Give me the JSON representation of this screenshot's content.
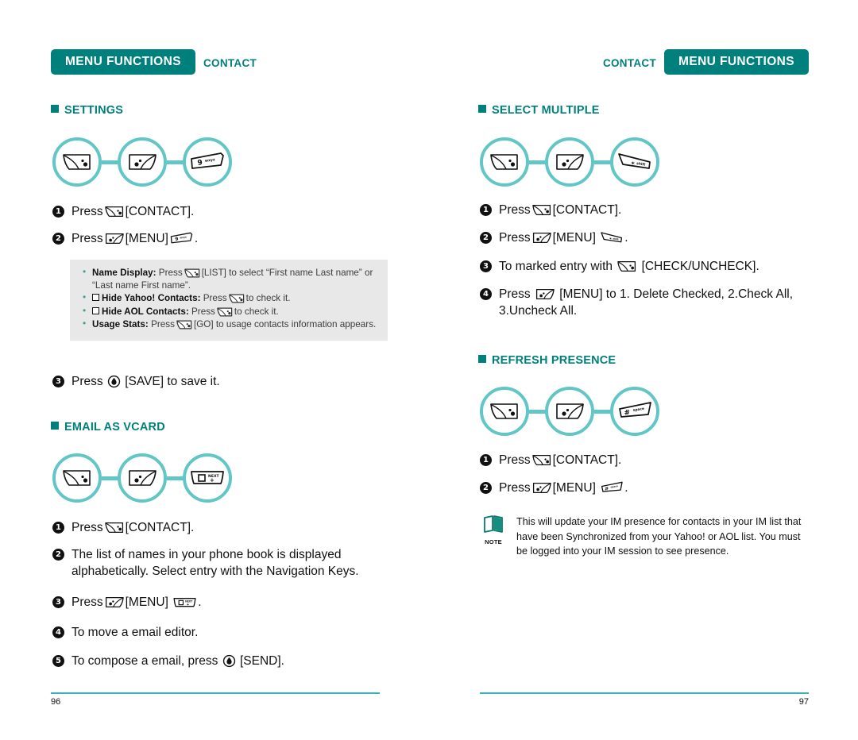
{
  "left_page": {
    "header": {
      "pill": "MENU FUNCTIONS",
      "side": "CONTACT"
    },
    "page_number": "96",
    "sections": [
      {
        "title": "SETTINGS",
        "icons": [
          "left-softkey",
          "right-softkey",
          "key-9-wxyz"
        ],
        "steps": [
          {
            "num": "1",
            "pre": "Press",
            "icons": [
              "left-softkey"
            ],
            "post": "[CONTACT]."
          },
          {
            "num": "2",
            "pre": "Press",
            "icons": [
              "right-softkey"
            ],
            "mid": "[MENU]",
            "icons2": [
              "key-9-wxyz"
            ],
            "post": "."
          },
          {
            "num": "3",
            "pre": "Press",
            "icons": [
              "ok-key"
            ],
            "post": "[SAVE] to save it."
          }
        ],
        "tips": [
          {
            "label": "Name Display:",
            "text_a": "Press",
            "icon": "left-softkey",
            "text_b": "[LIST] to select “First name Last name” or “Last name First name”.",
            "checkbox": false
          },
          {
            "label": "Hide Yahoo! Contacts:",
            "text_a": "Press",
            "icon": "left-softkey",
            "text_b": "to check it.",
            "checkbox": true
          },
          {
            "label": "Hide AOL Contacts:",
            "text_a": "Press",
            "icon": "left-softkey",
            "text_b": "to check it.",
            "checkbox": true
          },
          {
            "label": "Usage Stats:",
            "text_a": "Press",
            "icon": "left-softkey",
            "text_b": "[GO] to usage contacts information appears.",
            "checkbox": false
          }
        ]
      },
      {
        "title": "EMAIL AS VCARD",
        "icons": [
          "left-softkey",
          "right-softkey",
          "key-0-next"
        ],
        "steps": [
          {
            "num": "1",
            "pre": "Press",
            "icons": [
              "left-softkey"
            ],
            "post": "[CONTACT]."
          },
          {
            "num": "2",
            "pre": "The list of names in your phone book is displayed alphabetically. Select entry with the Navigation Keys.",
            "icons": [],
            "post": ""
          },
          {
            "num": "3",
            "pre": "Press",
            "icons": [
              "right-softkey"
            ],
            "mid": "[MENU]",
            "icons2": [
              "key-0-next"
            ],
            "post": "."
          },
          {
            "num": "4",
            "pre": "To move a email editor.",
            "icons": [],
            "post": ""
          },
          {
            "num": "5",
            "pre": "To compose a email, press",
            "icons": [
              "ok-key"
            ],
            "post": "[SEND]."
          }
        ]
      }
    ]
  },
  "right_page": {
    "header": {
      "pill": "MENU FUNCTIONS",
      "side": "CONTACT"
    },
    "page_number": "97",
    "sections": [
      {
        "title": "SELECT MULTIPLE",
        "icons": [
          "left-softkey",
          "right-softkey",
          "key-star-shift"
        ],
        "steps": [
          {
            "num": "1",
            "pre": "Press",
            "icons": [
              "left-softkey"
            ],
            "post": "[CONTACT]."
          },
          {
            "num": "2",
            "pre": "Press",
            "icons": [
              "right-softkey"
            ],
            "mid": "[MENU]",
            "icons2": [
              "key-star-shift"
            ],
            "post": "."
          },
          {
            "num": "3",
            "pre": "To marked entry with",
            "icons": [
              "left-softkey"
            ],
            "post": "[CHECK/UNCHECK]."
          },
          {
            "num": "4",
            "pre": "Press",
            "icons": [
              "right-softkey"
            ],
            "post": "[MENU] to 1. Delete Checked, 2.Check All, 3.Uncheck All."
          }
        ]
      },
      {
        "title": "REFRESH PRESENCE",
        "icons": [
          "left-softkey",
          "right-softkey",
          "key-hash-space"
        ],
        "steps": [
          {
            "num": "1",
            "pre": "Press",
            "icons": [
              "left-softkey"
            ],
            "post": "[CONTACT]."
          },
          {
            "num": "2",
            "pre": "Press",
            "icons": [
              "right-softkey"
            ],
            "mid": "[MENU]",
            "icons2": [
              "key-hash-space"
            ],
            "post": "."
          }
        ],
        "note": {
          "label": "NOTE",
          "text": "This will update your IM presence for contacts in your IM list that have been Synchronized from your Yahoo! or AOL list.  You must be logged into your IM session to see presence."
        }
      }
    ]
  },
  "colors": {
    "teal_dark": "#00807c",
    "teal_light": "#63c6c6",
    "rule": "#3cb3b3",
    "tip_bg": "#e8e8e8"
  },
  "key_labels": {
    "key-9-wxyz": "9 wxyz",
    "key-0-next": "0 NEXT +",
    "key-star-shift": "* shift",
    "key-hash-space": "# space"
  }
}
